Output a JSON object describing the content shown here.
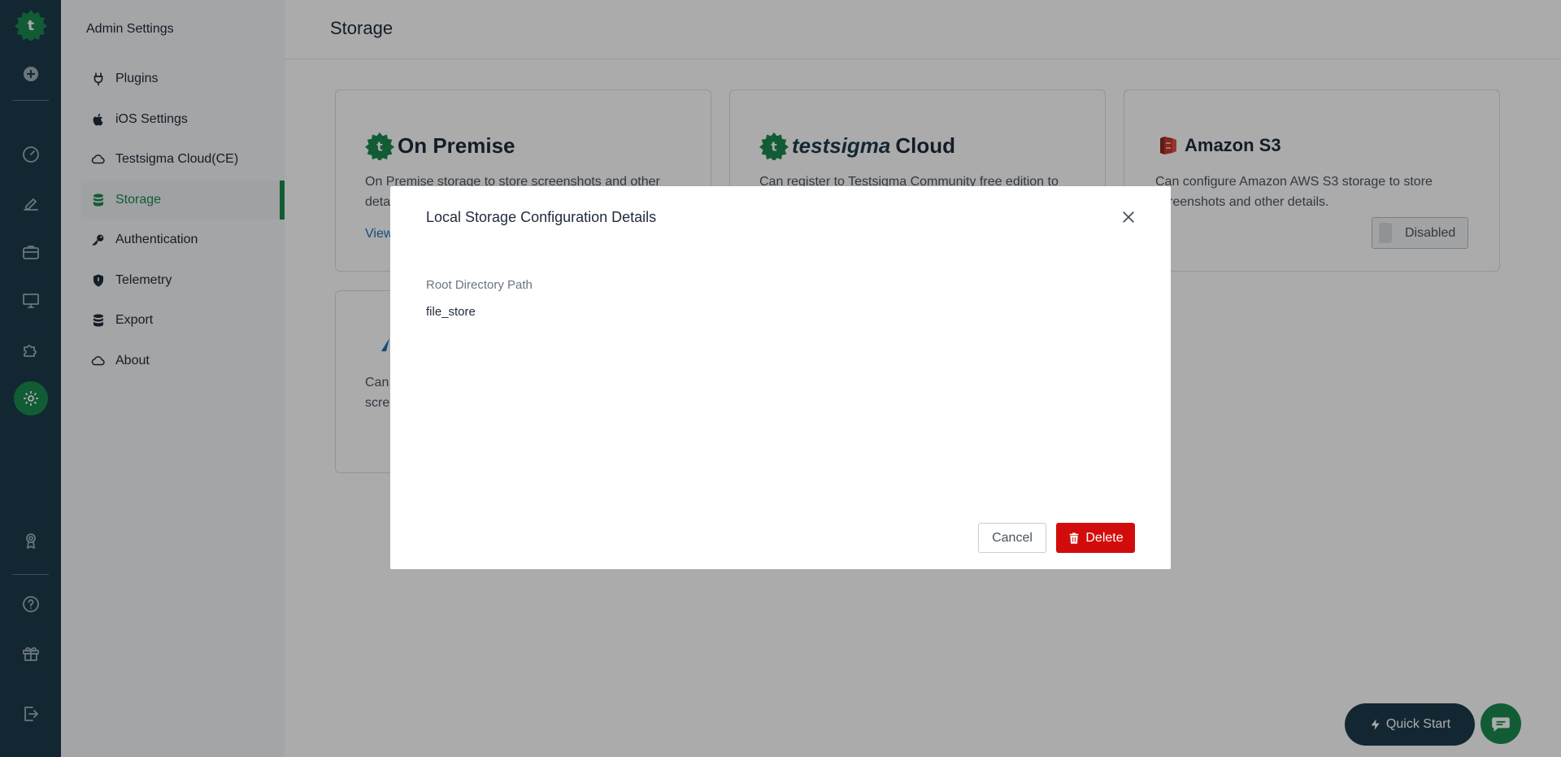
{
  "colors": {
    "rail_bg": "#1d3b4c",
    "brand_green": "#1c8a4f",
    "subnav_bg": "#f4f6f8",
    "danger": "#d20c0c",
    "link": "#1f6fb5",
    "aws_red": "#c7382d"
  },
  "rail": {
    "items": [
      {
        "icon": "add-circle-icon"
      },
      {
        "icon": "dashboard-icon"
      },
      {
        "icon": "edit-icon"
      },
      {
        "icon": "briefcase-icon"
      },
      {
        "icon": "monitor-icon"
      },
      {
        "icon": "puzzle-icon"
      },
      {
        "icon": "settings-gear-icon",
        "active": true
      },
      {
        "icon": "award-icon"
      },
      {
        "icon": "help-icon"
      },
      {
        "icon": "gift-icon"
      },
      {
        "icon": "logout-icon"
      }
    ]
  },
  "subnav": {
    "title": "Admin Settings",
    "items": [
      {
        "label": "Plugins",
        "icon": "plug-icon"
      },
      {
        "label": "iOS Settings",
        "icon": "apple-icon"
      },
      {
        "label": "Testsigma Cloud(CE)",
        "icon": "cloud-icon"
      },
      {
        "label": "Storage",
        "icon": "database-icon",
        "active": true
      },
      {
        "label": "Authentication",
        "icon": "key-icon"
      },
      {
        "label": "Telemetry",
        "icon": "shield-icon"
      },
      {
        "label": "Export",
        "icon": "database-icon"
      },
      {
        "label": "About",
        "icon": "cloud-icon"
      }
    ]
  },
  "main": {
    "title": "Storage",
    "cards": [
      {
        "name": "On Premise",
        "desc": "On Premise storage to store screenshots and other deta",
        "link": "View"
      },
      {
        "brand": "testsigma",
        "name": "Cloud",
        "desc": "Can register to Testsigma Community free edition to"
      },
      {
        "name": "Amazon S3",
        "desc": "Can configure Amazon AWS S3 storage to store screenshots and other details.",
        "toggle_label": "Disabled"
      },
      {
        "desc": "Can screenshots"
      }
    ]
  },
  "modal": {
    "title": "Local Storage Configuration Details",
    "field_label": "Root Directory Path",
    "field_value": "file_store",
    "cancel_label": "Cancel",
    "delete_label": "Delete"
  },
  "fab": {
    "quick_start_label": "Quick Start"
  }
}
